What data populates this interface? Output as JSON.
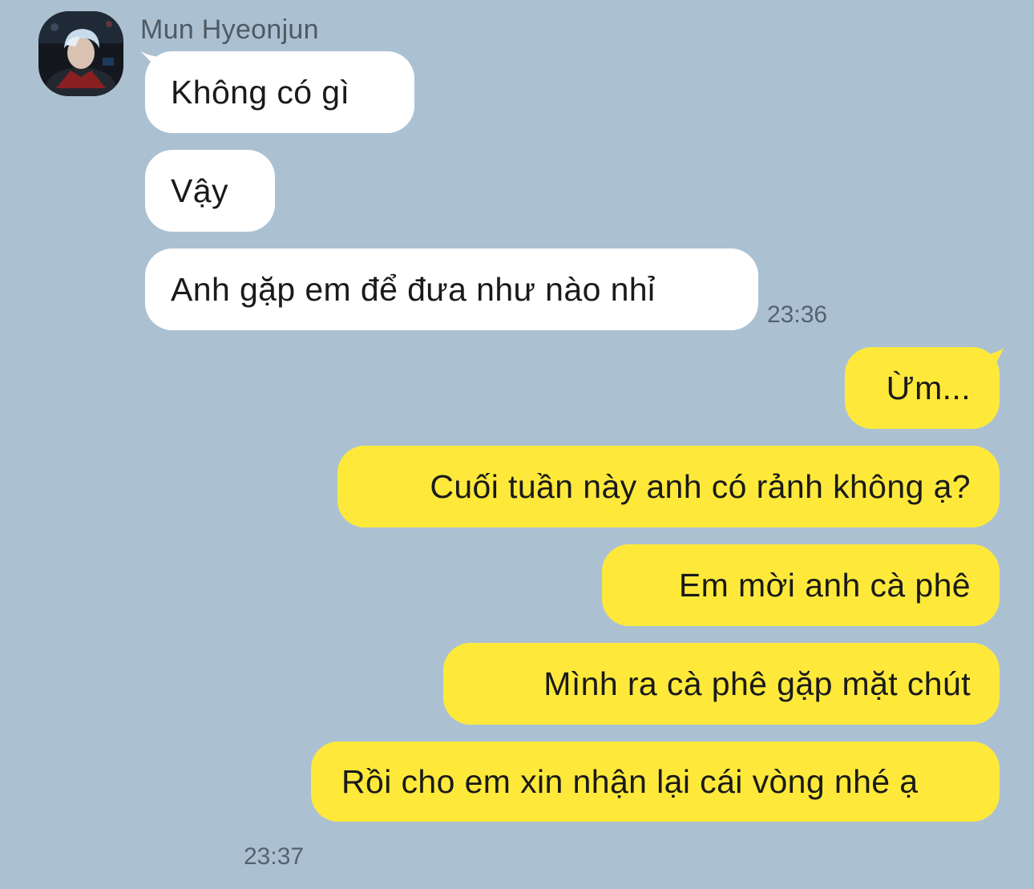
{
  "contact": {
    "name": "Mun Hyeonjun",
    "avatar_icon": "contact-avatar-photo"
  },
  "colors": {
    "background": "#abc1d2",
    "incoming_bubble": "#ffffff",
    "outgoing_bubble": "#fee93b",
    "timestamp": "#556270",
    "sender_name": "#4f5a63"
  },
  "incoming": {
    "messages": [
      "Không có gì",
      "Vậy",
      "Anh gặp em để đưa như nào nhỉ"
    ],
    "time": "23:36"
  },
  "outgoing": {
    "messages": [
      "Ừm...",
      "Cuối tuần này anh có rảnh không ạ?",
      "Em mời anh cà phê",
      "Mình ra cà phê gặp mặt chút",
      "Rồi cho em xin nhận lại cái vòng nhé ạ"
    ],
    "time": "23:37"
  }
}
